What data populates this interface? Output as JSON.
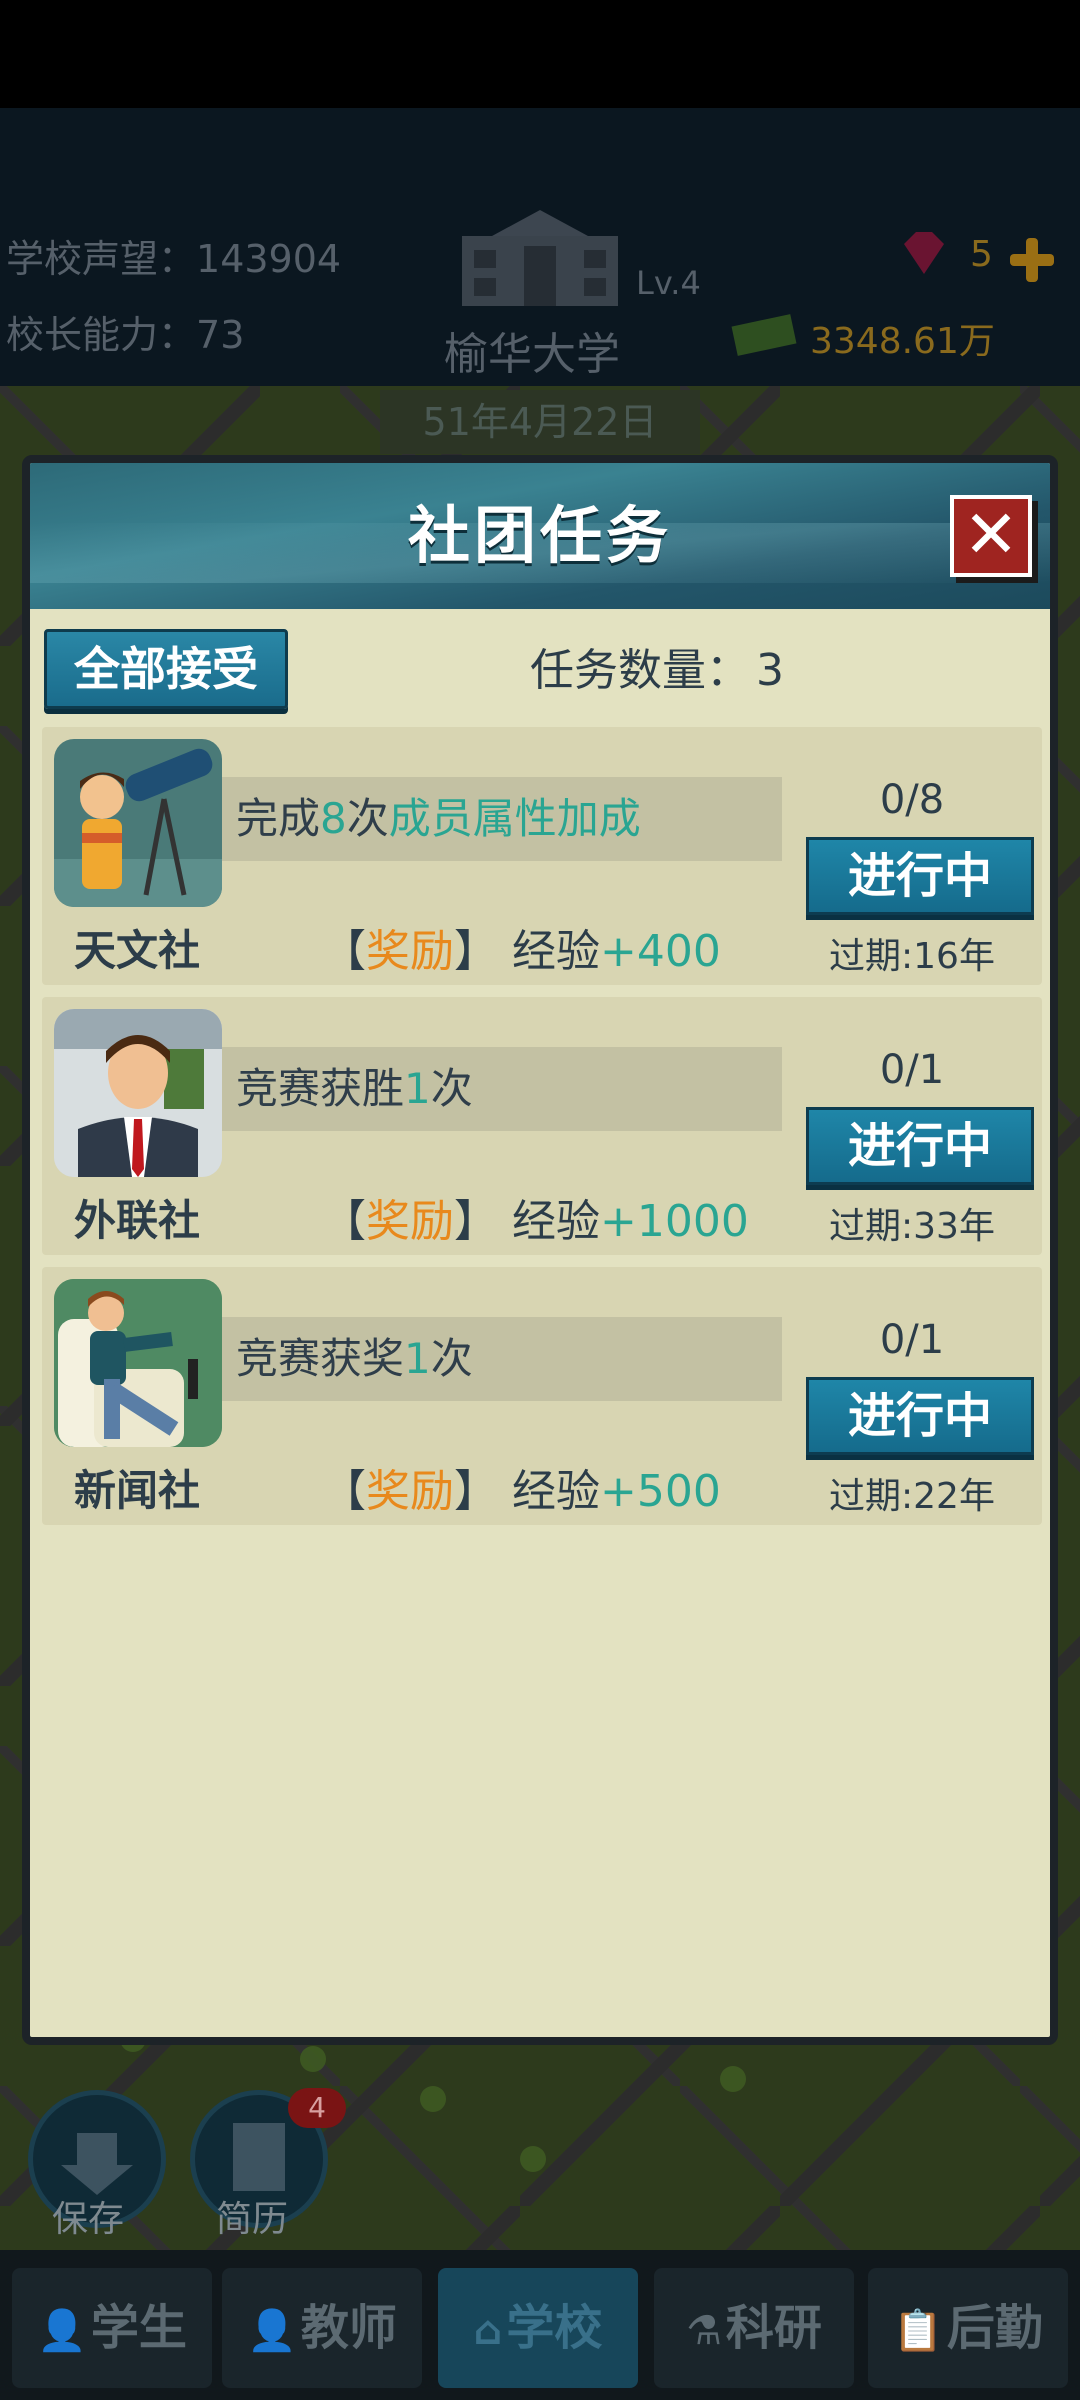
{
  "hud": {
    "reputation_label": "学校声望：",
    "reputation_value": "143904",
    "ability_label": "校长能力：",
    "ability_value": "73",
    "school_name": "榆华大学",
    "level": "Lv.4",
    "gems": "5",
    "money": "3348.61万",
    "date": "51年4月22日"
  },
  "side_buttons": [
    {
      "label": "保存"
    },
    {
      "label": "简历",
      "badge": "4"
    }
  ],
  "bottom_tabs": [
    {
      "label": "学生",
      "icon": "student-icon"
    },
    {
      "label": "教师",
      "icon": "teacher-icon"
    },
    {
      "label": "学校",
      "icon": "school-icon",
      "active": true
    },
    {
      "label": "科研",
      "icon": "flask-icon"
    },
    {
      "label": "后勤",
      "icon": "clipboard-icon"
    }
  ],
  "dialog": {
    "title": "社团任务",
    "close_glyph": "✕",
    "accept_all": "全部接受",
    "task_count_label": "任务数量：",
    "task_count": "3",
    "tasks": [
      {
        "club": "天文社",
        "desc_prefix": "完成",
        "desc_num": "8",
        "desc_suffix": "次",
        "desc_tail": "成员属性加成",
        "reward_open": "【",
        "reward_word": "奖励",
        "reward_close": "】",
        "reward_type": "经验",
        "reward_amount": "+400",
        "progress": "0/8",
        "status": "进行中",
        "expire": "过期:16年",
        "avatar": "telescope-kid"
      },
      {
        "club": "外联社",
        "desc_prefix": "竞赛获胜",
        "desc_num": "1",
        "desc_suffix": "次",
        "desc_tail": "",
        "reward_open": "【",
        "reward_word": "奖励",
        "reward_close": "】",
        "reward_type": "经验",
        "reward_amount": "+1000",
        "progress": "0/1",
        "status": "进行中",
        "expire": "过期:33年",
        "avatar": "businessman"
      },
      {
        "club": "新闻社",
        "desc_prefix": "竞赛获奖",
        "desc_num": "1",
        "desc_suffix": "次",
        "desc_tail": "",
        "reward_open": "【",
        "reward_word": "奖励",
        "reward_close": "】",
        "reward_type": "经验",
        "reward_amount": "+500",
        "progress": "0/1",
        "status": "进行中",
        "expire": "过期:22年",
        "avatar": "interviewee"
      }
    ]
  },
  "colors": {
    "accent_teal": "#2aa592",
    "reward_orange": "#e8891c",
    "button_blue": "#1a6c8c",
    "panel_bg": "#e3e2c1",
    "close_red": "#9f2420"
  }
}
